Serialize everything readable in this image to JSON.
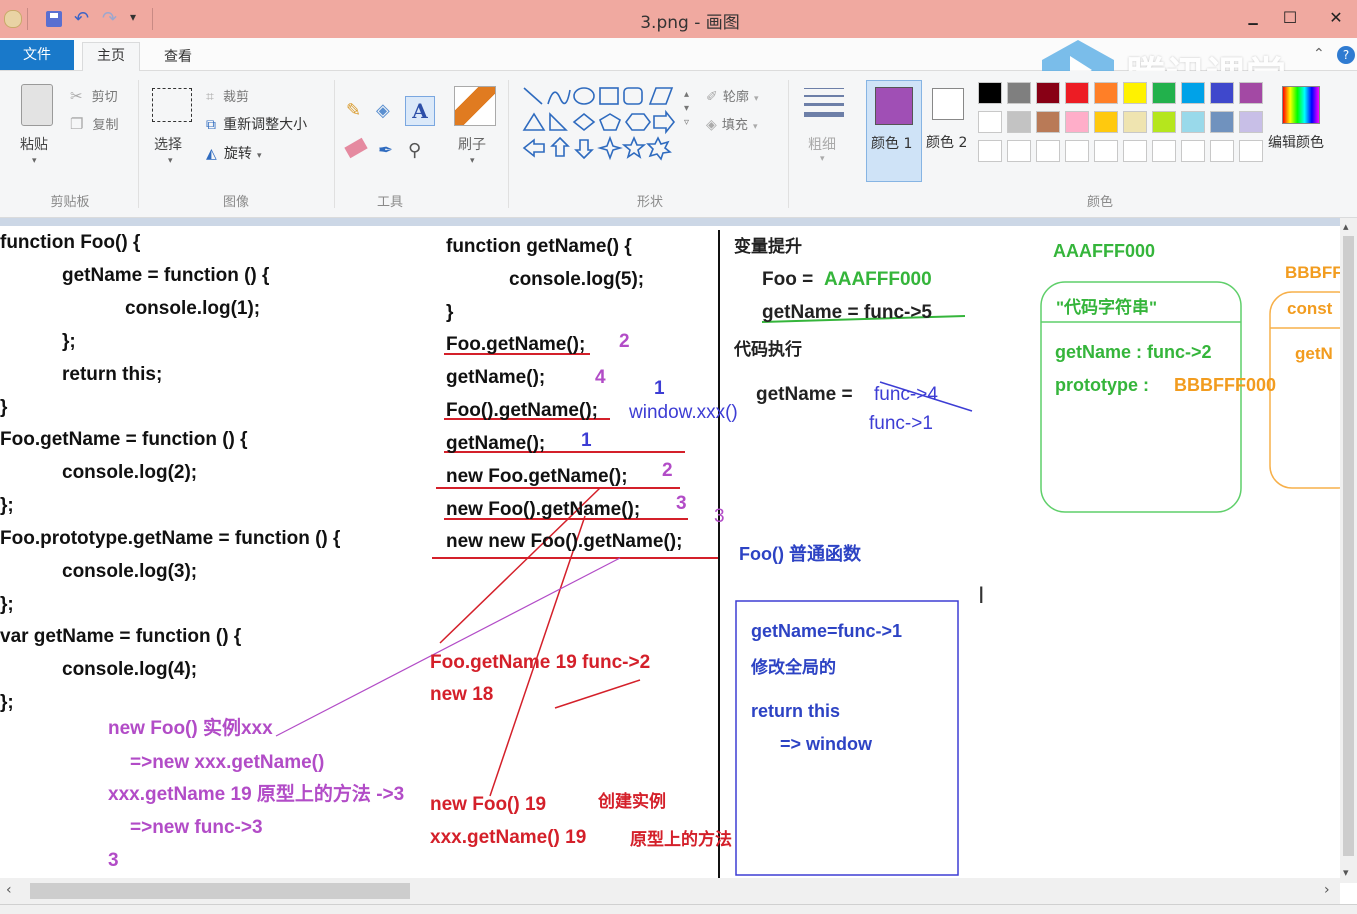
{
  "window": {
    "title": "3.png - 画图",
    "minimize": "▁",
    "maximize": "☐",
    "close": "✕"
  },
  "tabs": {
    "file": "文件",
    "home": "主页",
    "view": "查看"
  },
  "ribbon": {
    "clipboard": {
      "paste": "粘贴",
      "cut": "剪切",
      "copy": "复制",
      "group": "剪贴板"
    },
    "image": {
      "select": "选择",
      "crop": "裁剪",
      "resize": "重新调整大小",
      "rotate": "旋转",
      "group": "图像"
    },
    "tools": {
      "group": "工具"
    },
    "brushes": {
      "label": "刷子"
    },
    "shapes": {
      "outline": "轮廓",
      "fill": "填充",
      "group": "形状"
    },
    "size": {
      "label": "粗细"
    },
    "colors": {
      "color1": "颜色 1",
      "color2": "颜色 2",
      "edit": "编辑颜色",
      "group": "颜色",
      "color1_value": "#a04fb5",
      "row1": [
        "#000000",
        "#7f7f7f",
        "#880015",
        "#ed1c24",
        "#ff7f27",
        "#fff200",
        "#22b14c",
        "#00a2e8",
        "#3f48cc",
        "#a349a4"
      ],
      "row2": [
        "#ffffff",
        "#c3c3c3",
        "#b97a57",
        "#ffaec9",
        "#ffc90e",
        "#efe4b0",
        "#b5e61d",
        "#99d9ea",
        "#7092be",
        "#c8bfe7"
      ],
      "row3": [
        "#ffffff",
        "#ffffff",
        "#ffffff",
        "#ffffff",
        "#ffffff",
        "#ffffff",
        "#ffffff",
        "#ffffff",
        "#ffffff",
        "#ffffff"
      ]
    }
  },
  "watermark": "腾讯课堂",
  "canvas": {
    "left_code": [
      "function Foo() {",
      "getName = function () {",
      "console.log(1);",
      "};",
      "return this;",
      "}",
      "Foo.getName = function () {",
      "console.log(2);",
      "};",
      "Foo.prototype.getName = function () {",
      "console.log(3);",
      "};",
      "var getName = function () {",
      "console.log(4);",
      "};"
    ],
    "left_notes": [
      "new Foo()   实例xxx",
      "=>new xxx.getName()",
      "xxx.getName  19   原型上的方法  ->3",
      "=>new func->3",
      "3"
    ],
    "mid_code": [
      "function getName() {",
      "console.log(5);",
      "}",
      "Foo.getName();",
      "getName();",
      "Foo().getName();",
      "getName();",
      "new Foo.getName();",
      "new Foo().getName();",
      "new new Foo().getName();"
    ],
    "mid_answers": [
      "2",
      "4",
      "1",
      "1",
      "2",
      "3",
      "3"
    ],
    "mid_window": "window.xxx()",
    "mid_notes": [
      "Foo.getName   19    func->2",
      "new  18",
      "new Foo() 19",
      "创建实例",
      "xxx.getName() 19",
      "原型上的方法"
    ],
    "right": {
      "hoist_title": "变量提升",
      "foo_label": "Foo = ",
      "foo_value": "AAAFFF000",
      "getname_hoist": "getName = func->5",
      "exec_title": "代码执行",
      "getname_exec_prefix": "getName = ",
      "getname_exec_struck": "func->4",
      "getname_exec_new": "func->1",
      "foo_plain": "Foo() 普通函数",
      "box_lines": [
        "getName=func->1",
        "修改全局的",
        "return this",
        "=> window"
      ]
    },
    "heap": {
      "addr_a": "AAAFFF000",
      "addr_b": "BBBFF",
      "code_string": "\"代码字符串\"",
      "getname": "getName : func->2",
      "prototype_label": "prototype :",
      "prototype_value": "BBBFFF000",
      "const_text": "const",
      "getn": "getN"
    }
  }
}
